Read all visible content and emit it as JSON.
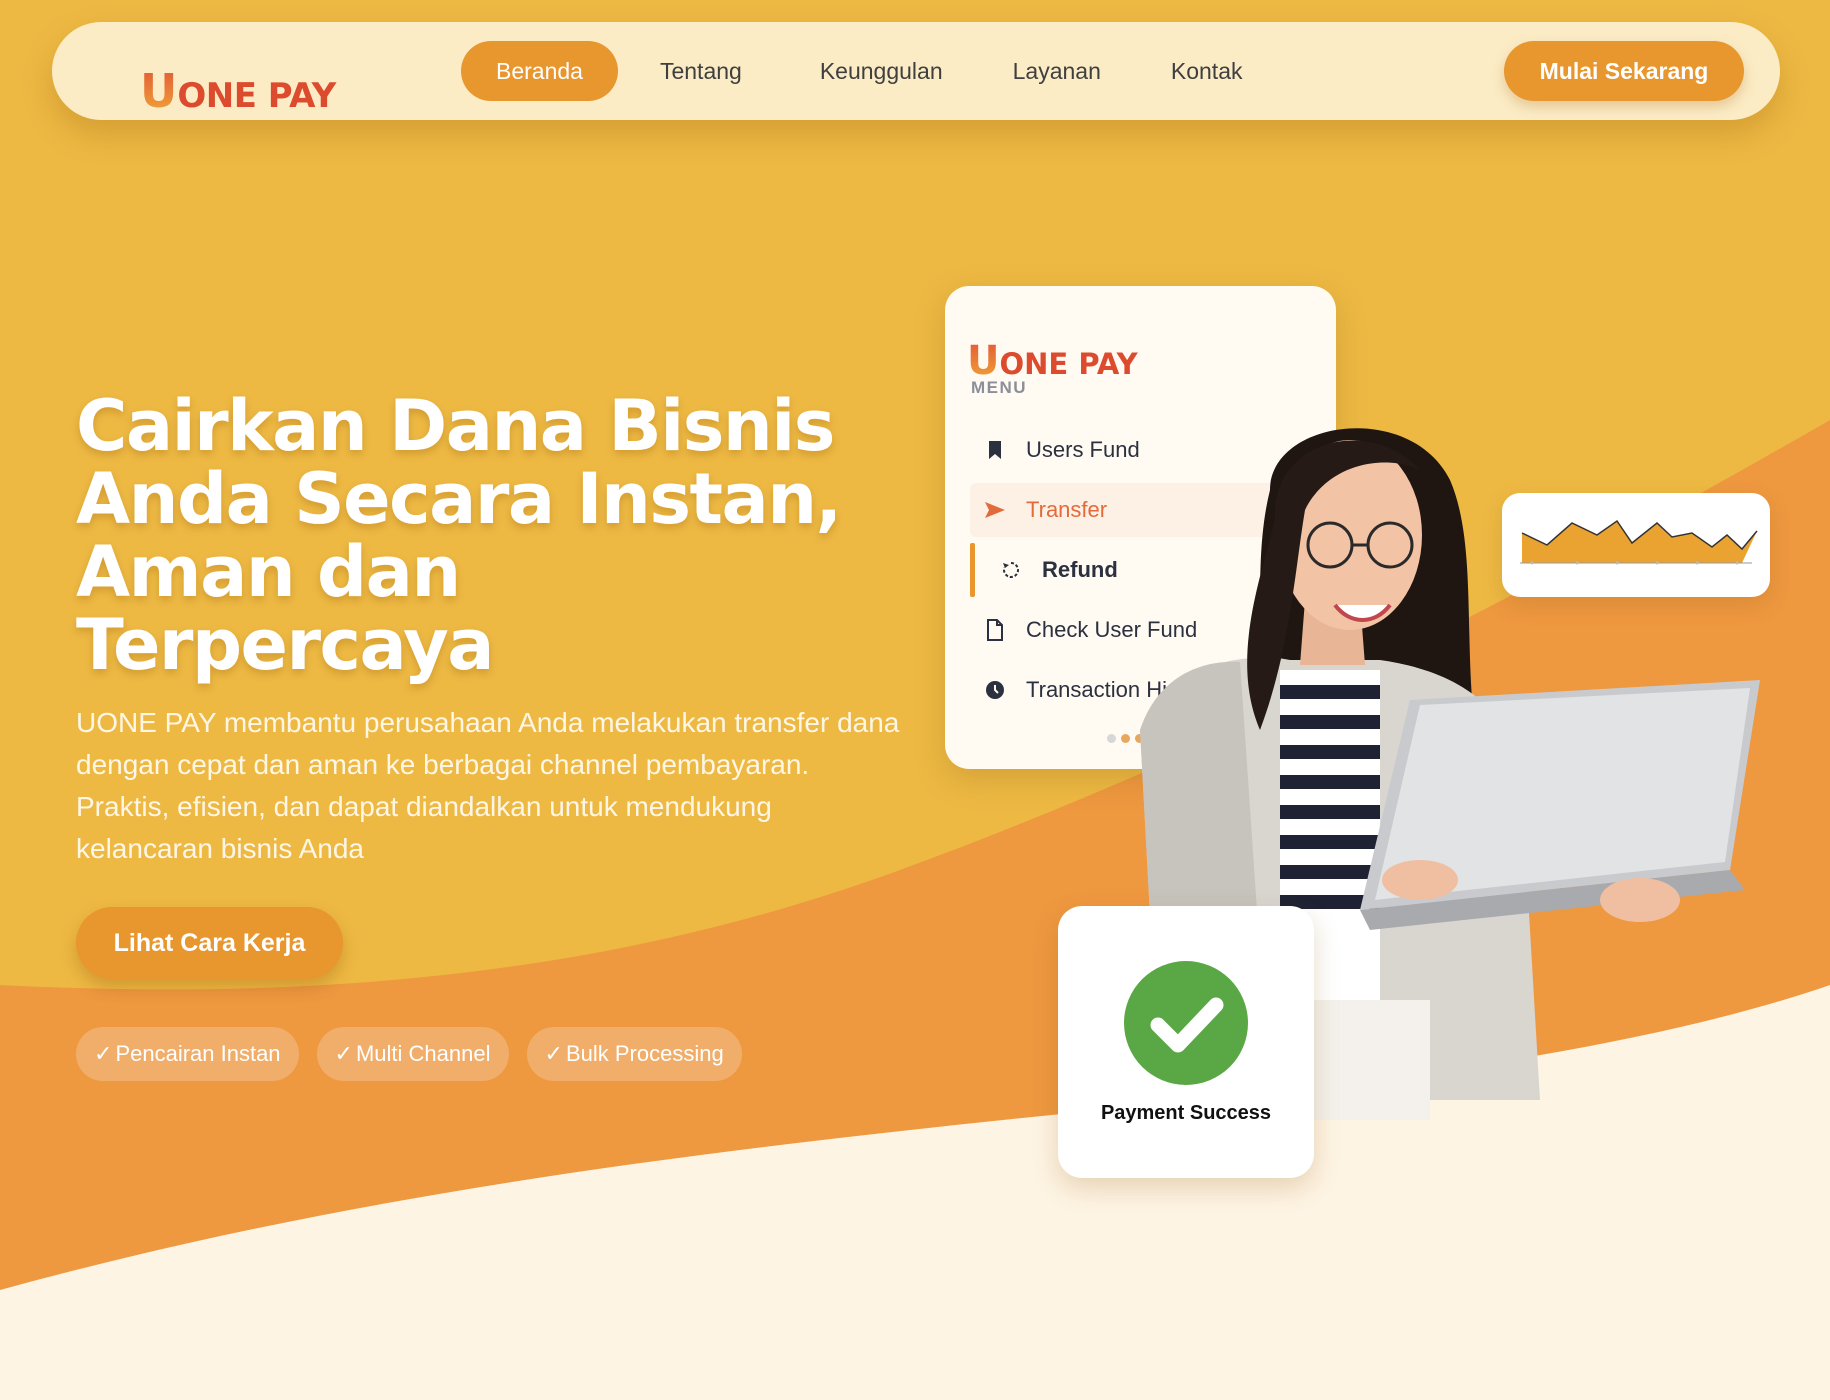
{
  "brand": {
    "logo_u": "U",
    "logo_rest": "ONE PAY"
  },
  "nav": {
    "items": [
      {
        "label": "Beranda",
        "active": true
      },
      {
        "label": "Tentang",
        "active": false
      },
      {
        "label": "Keunggulan",
        "active": false
      },
      {
        "label": "Layanan",
        "active": false
      },
      {
        "label": "Kontak",
        "active": false
      }
    ],
    "cta_label": "Mulai Sekarang"
  },
  "hero": {
    "title_lines": [
      "Cairkan Dana Bisnis",
      "Anda Secara Instan,",
      "Aman dan",
      "Terpercaya"
    ],
    "description": "UONE PAY membantu perusahaan Anda melakukan transfer dana dengan cepat dan aman ke berbagai channel pembayaran. Praktis, efisien, dan dapat diandalkan untuk mendukung kelancaran bisnis Anda",
    "cta_label": "Lihat Cara Kerja",
    "features": [
      "Pencairan Instan",
      "Multi Channel",
      "Bulk Processing"
    ],
    "check_glyph": "✓"
  },
  "menu_card": {
    "logo_u": "U",
    "logo_rest": "ONE PAY",
    "heading": "MENU",
    "items": [
      {
        "label": "Users Fund",
        "icon": "bookmark-icon"
      },
      {
        "label": "Transfer",
        "icon": "send-icon",
        "highlighted": true
      },
      {
        "label": "Refund",
        "icon": "refresh-icon",
        "selected": true
      },
      {
        "label": "Check User Fund",
        "icon": "document-icon"
      },
      {
        "label": "Transaction Hi",
        "icon": "clock-icon"
      }
    ]
  },
  "success_card": {
    "label": "Payment Success"
  },
  "colors": {
    "background_top": "#edb943",
    "wave_orange": "#ee9840",
    "bottom_cream": "#fef4e3",
    "accent": "#e8962e",
    "brand_red": "#dc4b2e",
    "success_green": "#5aa845"
  }
}
